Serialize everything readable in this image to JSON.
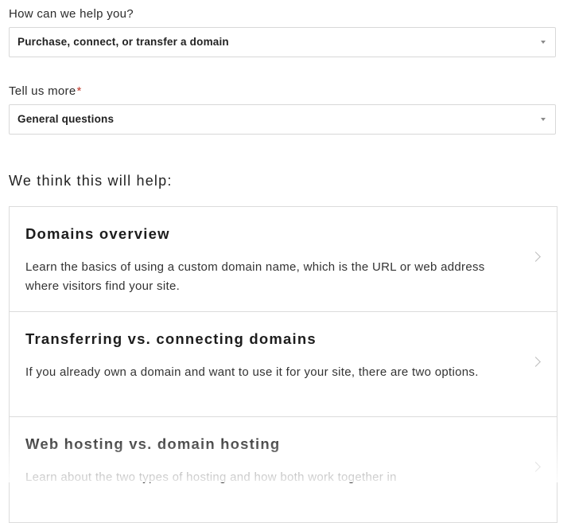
{
  "form": {
    "help_label": "How can we help you?",
    "help_value": "Purchase, connect, or transfer a domain",
    "more_label": "Tell us more",
    "required_mark": "*",
    "more_value": "General questions"
  },
  "suggestions": {
    "heading": "We think this will help:",
    "items": [
      {
        "title": "Domains overview",
        "description": "Learn the basics of using a custom domain name, which is the URL or web address where visitors find your site."
      },
      {
        "title": "Transferring vs. connecting domains",
        "description": "If you already own a domain and want to use it for your site, there are two options."
      },
      {
        "title": "Web hosting vs. domain hosting",
        "description": "Learn about the two types of hosting and how both work together in"
      }
    ]
  },
  "icons": {
    "select_caret": "caret-down-icon",
    "card_arrow": "chevron-right-icon"
  },
  "colors": {
    "required": "#c0392b",
    "border": "#d8d8d8"
  }
}
